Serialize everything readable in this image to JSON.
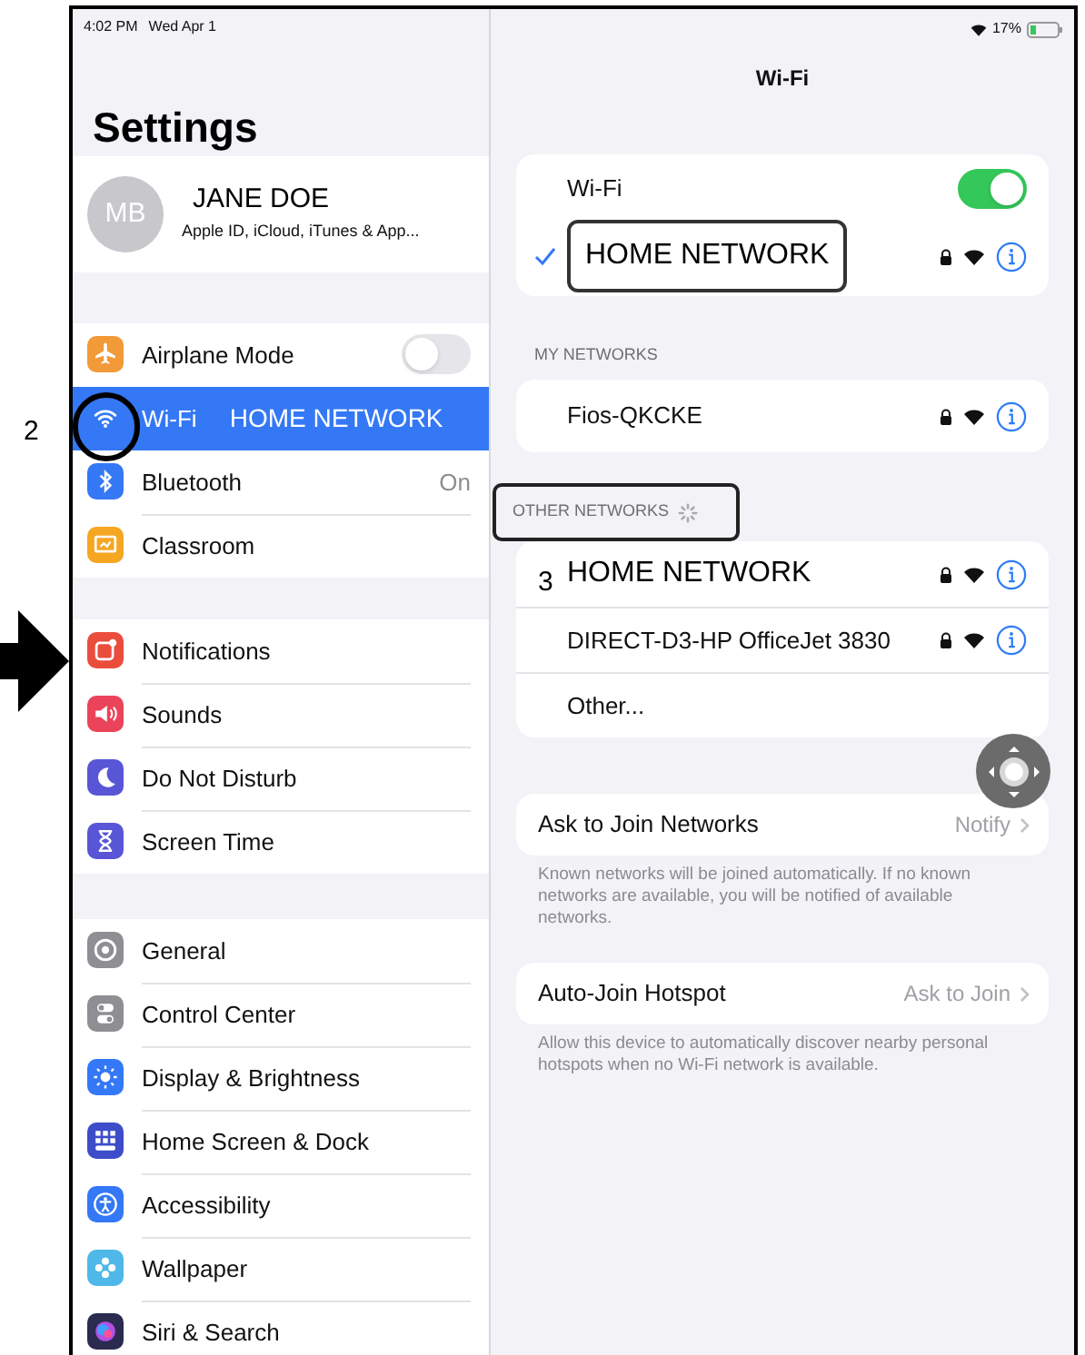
{
  "annotations": [
    {
      "text": "2"
    },
    {
      "text": "3"
    }
  ],
  "status_bar": {
    "time": "4:02 PM",
    "date": "Wed Apr 1",
    "battery": "17%"
  },
  "sidebar": {
    "title": "Settings",
    "profile": {
      "initials": "MB",
      "name": "JANE DOE",
      "subtitle": "Apple ID, iCloud, iTunes & App..."
    },
    "groups": [
      {
        "items": [
          {
            "label": "Airplane Mode",
            "color": "#f19a37",
            "kind": "toggle",
            "on": false,
            "selected": false
          },
          {
            "label": "Wi-Fi",
            "color": "#3478f6",
            "kind": "value",
            "value": "HOME NETWORK",
            "selected": true
          },
          {
            "label": "Bluetooth",
            "color": "#3478f6",
            "kind": "value",
            "value": "On",
            "selected": false
          },
          {
            "label": "Classroom",
            "color": "#f5a623",
            "kind": "plain",
            "selected": false
          }
        ]
      },
      {
        "items": [
          {
            "label": "Notifications",
            "color": "#eb4d3d",
            "kind": "plain",
            "selected": false
          },
          {
            "label": "Sounds",
            "color": "#eb445a",
            "kind": "plain",
            "selected": false
          },
          {
            "label": "Do Not Disturb",
            "color": "#5856d6",
            "kind": "plain",
            "selected": false
          },
          {
            "label": "Screen Time",
            "color": "#5856d6",
            "kind": "plain",
            "selected": false
          }
        ]
      },
      {
        "items": [
          {
            "label": "General",
            "color": "#8e8e93",
            "kind": "plain",
            "selected": false
          },
          {
            "label": "Control Center",
            "color": "#8e8e93",
            "kind": "plain",
            "selected": false
          },
          {
            "label": "Display & Brightness",
            "color": "#3478f6",
            "kind": "plain",
            "selected": false
          },
          {
            "label": "Home Screen & Dock",
            "color": "#3d4cc9",
            "kind": "plain",
            "selected": false
          },
          {
            "label": "Accessibility",
            "color": "#3478f6",
            "kind": "plain",
            "selected": false
          },
          {
            "label": "Wallpaper",
            "color": "#4fb8e8",
            "kind": "plain",
            "selected": false
          },
          {
            "label": "Siri & Search",
            "color": "#2b2b50",
            "kind": "plain",
            "selected": false
          }
        ]
      }
    ]
  },
  "wifi": {
    "title": "Wi-Fi",
    "main": {
      "label": "Wi-Fi",
      "on": true,
      "network": {
        "name": "HOME NETWORK",
        "selected": true,
        "locked": true
      }
    },
    "my_networks": {
      "header": "MY NETWORKS",
      "networks": [
        {
          "name": "Fios-QKCKE",
          "kind": "network",
          "locked": true
        }
      ]
    },
    "other_networks": {
      "header": "OTHER NETWORKS",
      "networks": [
        {
          "name": "HOME NETWORK",
          "kind": "network",
          "locked": true
        },
        {
          "name": "DIRECT-D3-HP OfficeJet 3830",
          "kind": "network",
          "locked": true
        },
        {
          "name": "Other...",
          "kind": "other"
        }
      ]
    },
    "settings": [
      {
        "label": "Ask to Join Networks",
        "value": "Notify",
        "footer": "Known networks will be joined automatically. If no known networks are available, you will be notified of available networks."
      },
      {
        "label": "Auto-Join Hotspot",
        "value": "Ask to Join",
        "footer": "Allow this device to automatically discover nearby personal hotspots when no Wi-Fi network is available."
      }
    ]
  }
}
